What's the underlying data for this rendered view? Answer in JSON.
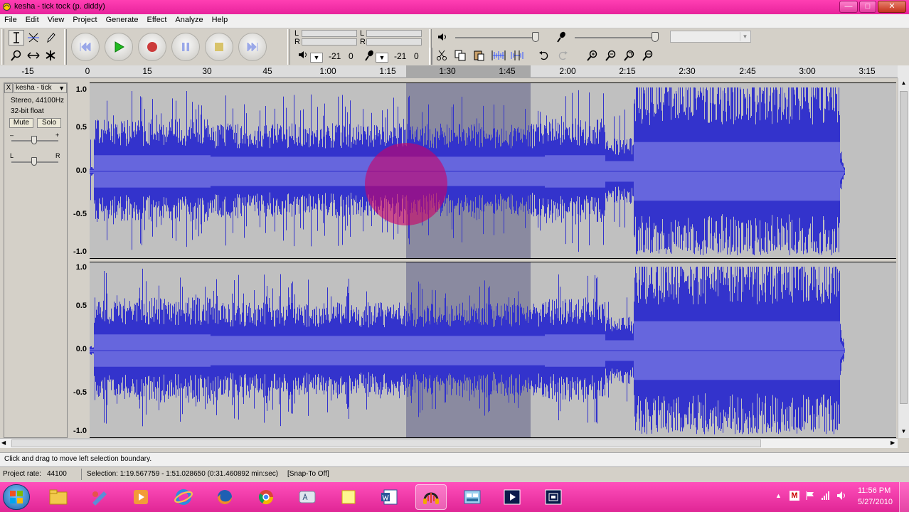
{
  "window": {
    "title": "kesha - tick tock (p. diddy)",
    "min_label": "—",
    "max_label": "□",
    "close_label": "✕"
  },
  "menu": [
    "File",
    "Edit",
    "View",
    "Project",
    "Generate",
    "Effect",
    "Analyze",
    "Help"
  ],
  "meters": {
    "left_label": "L",
    "right_label": "R",
    "play_db": "-21",
    "play_zero": "0",
    "rec_db": "-21",
    "rec_zero": "0"
  },
  "ruler": {
    "ticks": [
      "-15",
      "0",
      "15",
      "30",
      "45",
      "1:00",
      "1:15",
      "1:30",
      "1:45",
      "2:00",
      "2:15",
      "2:30",
      "2:45",
      "3:00",
      "3:15"
    ]
  },
  "track": {
    "name": "kesha - tick",
    "format": "Stereo, 44100Hz",
    "bitdepth": "32-bit float",
    "mute": "Mute",
    "solo": "Solo",
    "gain_minus": "–",
    "gain_plus": "+",
    "pan_left": "L",
    "pan_right": "R",
    "close": "X",
    "menu_arrow": "▼",
    "scale": [
      "1.0",
      "0.5",
      "0.0",
      "-0.5",
      "-1.0"
    ]
  },
  "status": {
    "message": "Click and drag to move left selection boundary.",
    "rate_label": "Project rate:",
    "rate_value": "44100",
    "selection": "Selection: 1:19.567759 - 1:51.028650 (0:31.460892 min:sec)",
    "snap": "[Snap-To Off]"
  },
  "taskbar": {
    "time": "11:56 PM",
    "date": "5/27/2010",
    "tray_m": "M"
  },
  "colors": {
    "titlebar": "#ff3fb3",
    "wave_dark": "#3333cc",
    "wave_light": "#6666dd",
    "selection": "#8a8aa0",
    "cursor_circle": "#cc0066"
  },
  "icons": {
    "select_tool": "i-beam-icon",
    "envelope_tool": "envelope-icon",
    "draw_tool": "pencil-icon",
    "zoom_tool": "magnifier-icon",
    "timeshift_tool": "double-arrow-icon",
    "multi_tool": "asterisk-icon"
  }
}
